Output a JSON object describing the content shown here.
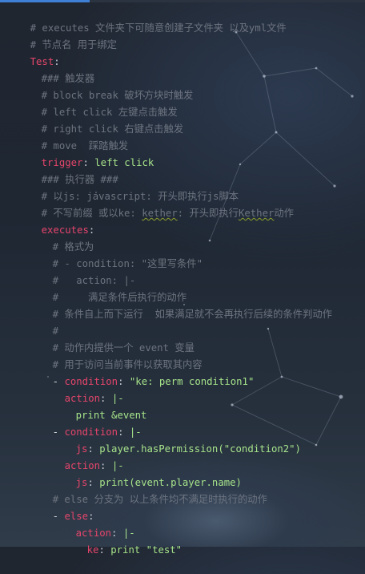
{
  "editor": {
    "lines": {
      "l1": {
        "comment": "# executes 文件夹下可随意创建子文件夹 以及yml文件"
      },
      "l2": {
        "comment": "# 节点名 用于绑定"
      },
      "l3": {
        "key": "Test",
        "colon": ":"
      },
      "l4": {
        "comment": "### 触发器"
      },
      "l5": {
        "comment": "# block break 破坏方块时触发"
      },
      "l6": {
        "comment": "# left click 左键点击触发"
      },
      "l7": {
        "comment": "# right click 右键点击触发"
      },
      "l8": {
        "comment": "# move  踩踏触发"
      },
      "l9": {
        "key": "trigger",
        "colon": ":",
        "value": "left click"
      },
      "l10": {
        "comment": "### 执行器 ###"
      },
      "l11": {
        "comment": "# 以js: javascript: 开头即执行js脚本"
      },
      "l12": {
        "comment_a": "# 不写前缀 或以ke: ",
        "comment_b": "kether",
        "comment_c": ": 开头即执行",
        "comment_d": "Kether",
        "comment_e": "动作"
      },
      "l13": {
        "key": "executes",
        "colon": ":"
      },
      "l14": {
        "comment": "# 格式为"
      },
      "l15": {
        "comment": "# - condition: \"这里写条件\""
      },
      "l16": {
        "comment": "#   action: |-"
      },
      "l17": {
        "comment": "#     满足条件后执行的动作"
      },
      "l18": {
        "comment": "# 条件自上而下运行  如果满足就不会再执行后续的条件判动作"
      },
      "l19": {
        "comment": "#"
      },
      "l20": {
        "comment": "# 动作内提供一个 event 变量"
      },
      "l21": {
        "comment": "# 用于访问当前事件以获取其内容"
      },
      "l22": {
        "dash": "- ",
        "key": "condition",
        "colon": ":",
        "value": "\"ke: perm condition1\""
      },
      "l23": {
        "key": "action",
        "colon": ":",
        "value": "|-"
      },
      "l24": {
        "value": "print &event"
      },
      "l25": {
        "dash": "- ",
        "key": "condition",
        "colon": ":",
        "value": "|-"
      },
      "l26": {
        "key": "js",
        "colon": ":",
        "value": "player.hasPermission(\"condition2\")"
      },
      "l27": {
        "key": "action",
        "colon": ":",
        "value": "|-"
      },
      "l28": {
        "key": "js",
        "colon": ":",
        "value": "print(event.player.name)"
      },
      "l29": {
        "comment": "# else 分支为 以上条件均不满足时执行的动作"
      },
      "l30": {
        "dash": "- ",
        "key": "else",
        "colon": ":"
      },
      "l31": {
        "key": "action",
        "colon": ":",
        "value": "|-"
      },
      "l32": {
        "key": "ke",
        "colon": ":",
        "value": "print \"test\""
      }
    }
  },
  "theme": {
    "comment_color": "#6d7480",
    "key_color": "#e6456b",
    "value_color": "#a6e38a",
    "accent": "#3f7fd6"
  }
}
